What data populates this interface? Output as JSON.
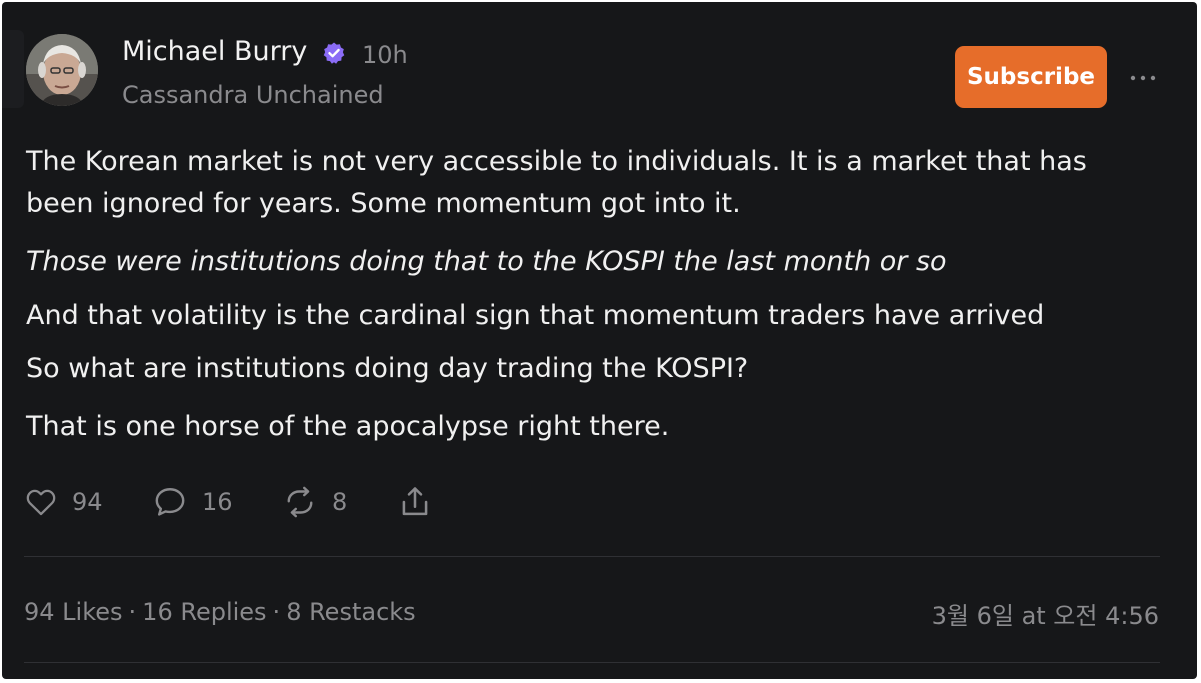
{
  "author": {
    "name": "Michael Burry",
    "publication": "Cassandra Unchained",
    "verified": true,
    "avatar_icon": "person-avatar"
  },
  "post": {
    "time_ago": "10h",
    "paragraphs": [
      {
        "line1": "The Korean market is not very accessible to individuals. It is a market that has",
        "line2": "been ignored for years. Some momentum got into it."
      },
      {
        "text": "Those were institutions doing that to the KOSPI the last month or so",
        "italic": true
      },
      {
        "text": "And that volatility is the cardinal sign that momentum traders have arrived"
      },
      {
        "text": "So what are institutions doing day trading the KOSPI?"
      },
      {
        "text": "That is one horse of the apocalypse right there."
      }
    ]
  },
  "header": {
    "subscribe_label": "Subscribe",
    "more_icon": "more-horizontal-icon"
  },
  "actions": {
    "likes": "94",
    "replies": "16",
    "restacks": "8",
    "share_icon": "share-icon"
  },
  "footer": {
    "likes_text": "94 Likes",
    "replies_text": "16 Replies",
    "restacks_text": "8 Restacks",
    "separator": "·",
    "timestamp": "3월 6일 at 오전 4:56"
  },
  "colors": {
    "background": "#161719",
    "accent": "#e66d2a",
    "verified": "#8b6cf6",
    "muted_text": "#8a8a8d",
    "text": "#f0f0f0"
  }
}
